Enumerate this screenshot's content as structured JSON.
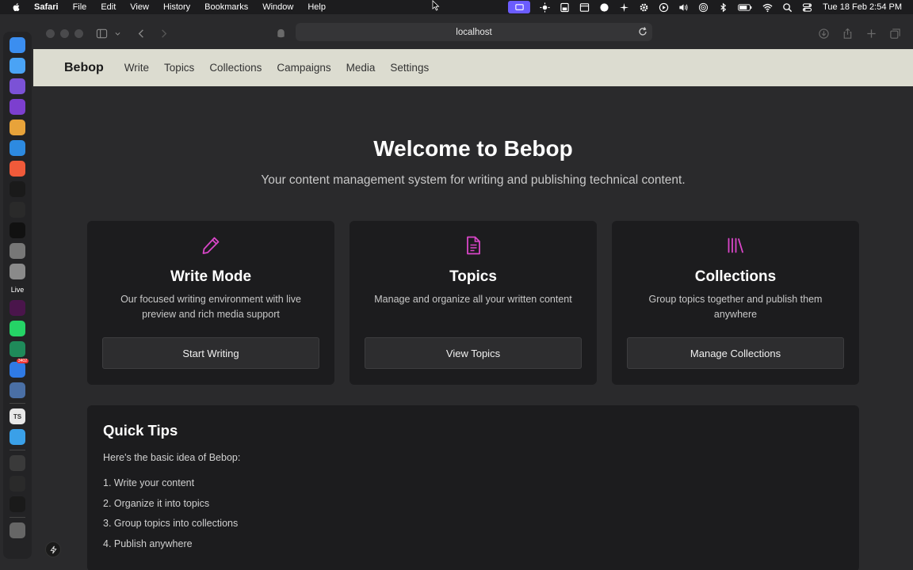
{
  "menubar": {
    "app_name": "Safari",
    "items": [
      "File",
      "Edit",
      "View",
      "History",
      "Bookmarks",
      "Window",
      "Help"
    ],
    "clock": "Tue 18 Feb  2:54 PM",
    "status_icons": [
      "screen-record-icon",
      "brightness-icon",
      "display-icon",
      "window-icon",
      "cloud-icon",
      "fan-icon",
      "gear-icon",
      "play-icon",
      "volume-icon",
      "airdrop-icon",
      "bluetooth-icon",
      "battery-icon",
      "wifi-icon",
      "search-icon",
      "control-center-icon"
    ]
  },
  "dock": {
    "apps": [
      {
        "name": "finder-icon",
        "color": "#3b8ef0"
      },
      {
        "name": "safari-icon",
        "color": "#4aa3f5"
      },
      {
        "name": "obsidian-icon",
        "color": "#7b52d6"
      },
      {
        "name": "github-desktop-icon",
        "color": "#7c3fcf"
      },
      {
        "name": "chrome-icon",
        "color": "#e8a33a"
      },
      {
        "name": "vscode-icon",
        "color": "#2d8ae0"
      },
      {
        "name": "raycast-icon",
        "color": "#f05a3a"
      },
      {
        "name": "spotify-icon",
        "color": "#1a1a1a"
      },
      {
        "name": "cursor-app-icon",
        "color": "#2a2a2a"
      },
      {
        "name": "terminal-icon",
        "color": "#111"
      },
      {
        "name": "system-settings-icon",
        "color": "#777"
      },
      {
        "name": "calculator-icon",
        "color": "#8a8a8a"
      }
    ],
    "live_label": "Live",
    "apps2": [
      {
        "name": "slack-icon",
        "color": "#4a154b"
      },
      {
        "name": "whatsapp-icon",
        "color": "#25d366"
      },
      {
        "name": "scanner-icon",
        "color": "#1f8a5a"
      },
      {
        "name": "mail-icon",
        "color": "#2f7ae5",
        "badge": "3402"
      },
      {
        "name": "preview-icon",
        "color": "#4a6fa5"
      },
      {
        "name": "typescript-file-icon",
        "color": "#e8e8e8",
        "text": "TS"
      },
      {
        "name": "folder-icon",
        "color": "#3aa0e8"
      },
      {
        "name": "window-thumbnail-icon",
        "color": "#3a3a3a"
      },
      {
        "name": "window-thumbnail-icon-2",
        "color": "#2a2a2a"
      },
      {
        "name": "window-thumbnail-icon-3",
        "color": "#1a1a1a"
      },
      {
        "name": "trash-icon",
        "color": "#666"
      }
    ]
  },
  "browser": {
    "url": "localhost"
  },
  "app": {
    "brand": "Bebop",
    "nav": [
      "Write",
      "Topics",
      "Collections",
      "Campaigns",
      "Media",
      "Settings"
    ]
  },
  "hero": {
    "title": "Welcome to Bebop",
    "subtitle": "Your content management system for writing and publishing technical content."
  },
  "cards": [
    {
      "icon": "pencil-icon",
      "title": "Write Mode",
      "description": "Our focused writing environment with live preview and rich media support",
      "button": "Start Writing"
    },
    {
      "icon": "document-icon",
      "title": "Topics",
      "description": "Manage and organize all your written content",
      "button": "View Topics"
    },
    {
      "icon": "library-icon",
      "title": "Collections",
      "description": "Group topics together and publish them anywhere",
      "button": "Manage Collections"
    }
  ],
  "tips": {
    "title": "Quick Tips",
    "intro": "Here's the basic idea of Bebop:",
    "items": [
      "1. Write your content",
      "2. Organize it into topics",
      "3. Group topics into collections",
      "4. Publish anywhere"
    ]
  },
  "colors": {
    "accent": "#d946c8",
    "nav_background": "#dcdcd0",
    "page_background": "#2a2a2c",
    "card_background": "#1c1c1e"
  }
}
